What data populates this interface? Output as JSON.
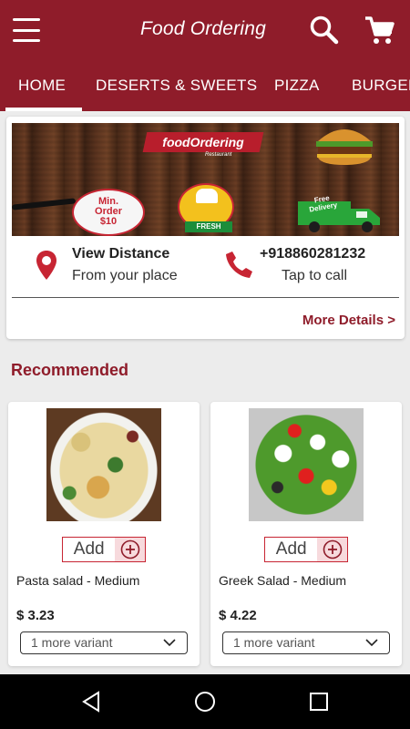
{
  "appbar": {
    "title": "Food Ordering"
  },
  "tabs": [
    {
      "label": "HOME"
    },
    {
      "label": "DESERTS & SWEETS"
    },
    {
      "label": "PIZZA"
    },
    {
      "label": "BURGER"
    }
  ],
  "banner": {
    "logo": "foodOrdering",
    "logo_sub": "Restaurant",
    "min_order": [
      "Min.",
      "Order",
      "$10"
    ],
    "fresh": "FRESH",
    "free_delivery": [
      "Free",
      "Delivery"
    ]
  },
  "info": {
    "distance_title": "View Distance",
    "distance_sub": "From your place",
    "phone": "+918860281232",
    "phone_sub": "Tap to call",
    "more_details": "More Details >"
  },
  "recommended": {
    "title": "Recommended",
    "items": [
      {
        "name": "Pasta salad - Medium",
        "price": "$ 3.23",
        "add_label": "Add",
        "variant": "1 more variant"
      },
      {
        "name": "Greek Salad - Medium",
        "price": "$ 4.22",
        "add_label": "Add",
        "variant": "1 more variant"
      }
    ]
  },
  "colors": {
    "primary": "#8f1c2a",
    "accent": "#c72533"
  }
}
